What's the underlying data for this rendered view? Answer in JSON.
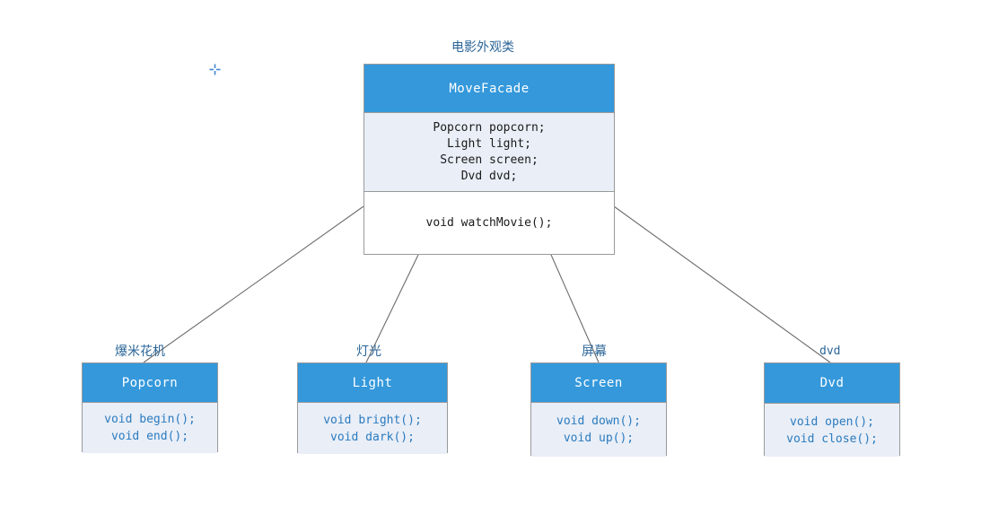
{
  "diagram": {
    "title_label": "电影外观类",
    "facade": {
      "name": "MoveFacade",
      "attributes": [
        "Popcorn popcorn;",
        "Light light;",
        "Screen screen;",
        "Dvd dvd;"
      ],
      "operations": [
        "void watchMovie();"
      ]
    },
    "subsystems": [
      {
        "annotation": "爆米花机",
        "name": "Popcorn",
        "operations": [
          "void begin();",
          "void end();"
        ]
      },
      {
        "annotation": "灯光",
        "name": "Light",
        "operations": [
          "void bright();",
          "void dark();"
        ]
      },
      {
        "annotation": "屏幕",
        "name": "Screen",
        "operations": [
          "void down();",
          "void up();"
        ]
      },
      {
        "annotation": "dvd",
        "name": "Dvd",
        "operations": [
          "void open();",
          "void close();"
        ]
      }
    ],
    "marker": "plus-crosshair-marker"
  },
  "colors": {
    "header_blue": "#3498db",
    "compartment_fill": "#e9eef7",
    "border_gray": "#9a9a9a",
    "annotation_blue": "#2b6698",
    "leaf_text_blue": "#2b7bbf",
    "connector_gray": "#6b6b6b",
    "marker_blue": "#3f86d4",
    "canvas_white": "#ffffff"
  }
}
